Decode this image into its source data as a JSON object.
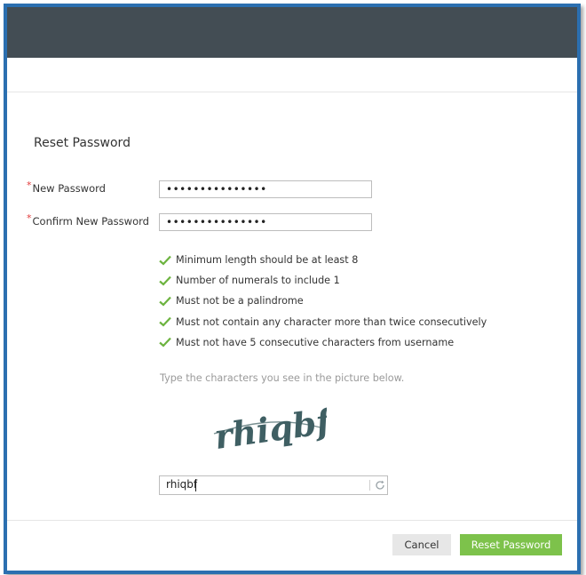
{
  "form": {
    "title": "Reset Password",
    "new_password_label": "New Password",
    "confirm_password_label": "Confirm New Password",
    "required_mark": "*",
    "new_password_value": "•••••••••••••••",
    "confirm_password_value": "•••••••••••••••"
  },
  "rules": [
    "Minimum length should be at least 8",
    "Number of numerals to include 1",
    "Must not be a palindrome",
    "Must not contain any character more than twice consecutively",
    "Must not have 5 consecutive characters from username"
  ],
  "captcha": {
    "hint": "Type the characters you see in the picture below.",
    "image_text": "rhiqbf",
    "input_value": "rhiqbf",
    "refresh_icon": "refresh-icon"
  },
  "footer": {
    "cancel_label": "Cancel",
    "reset_label": "Reset Password"
  },
  "colors": {
    "topbar": "#434d54",
    "frame_border": "#2b6fb0",
    "check": "#6cb33f",
    "primary_button": "#7dc24b",
    "required": "#e23b3b"
  }
}
